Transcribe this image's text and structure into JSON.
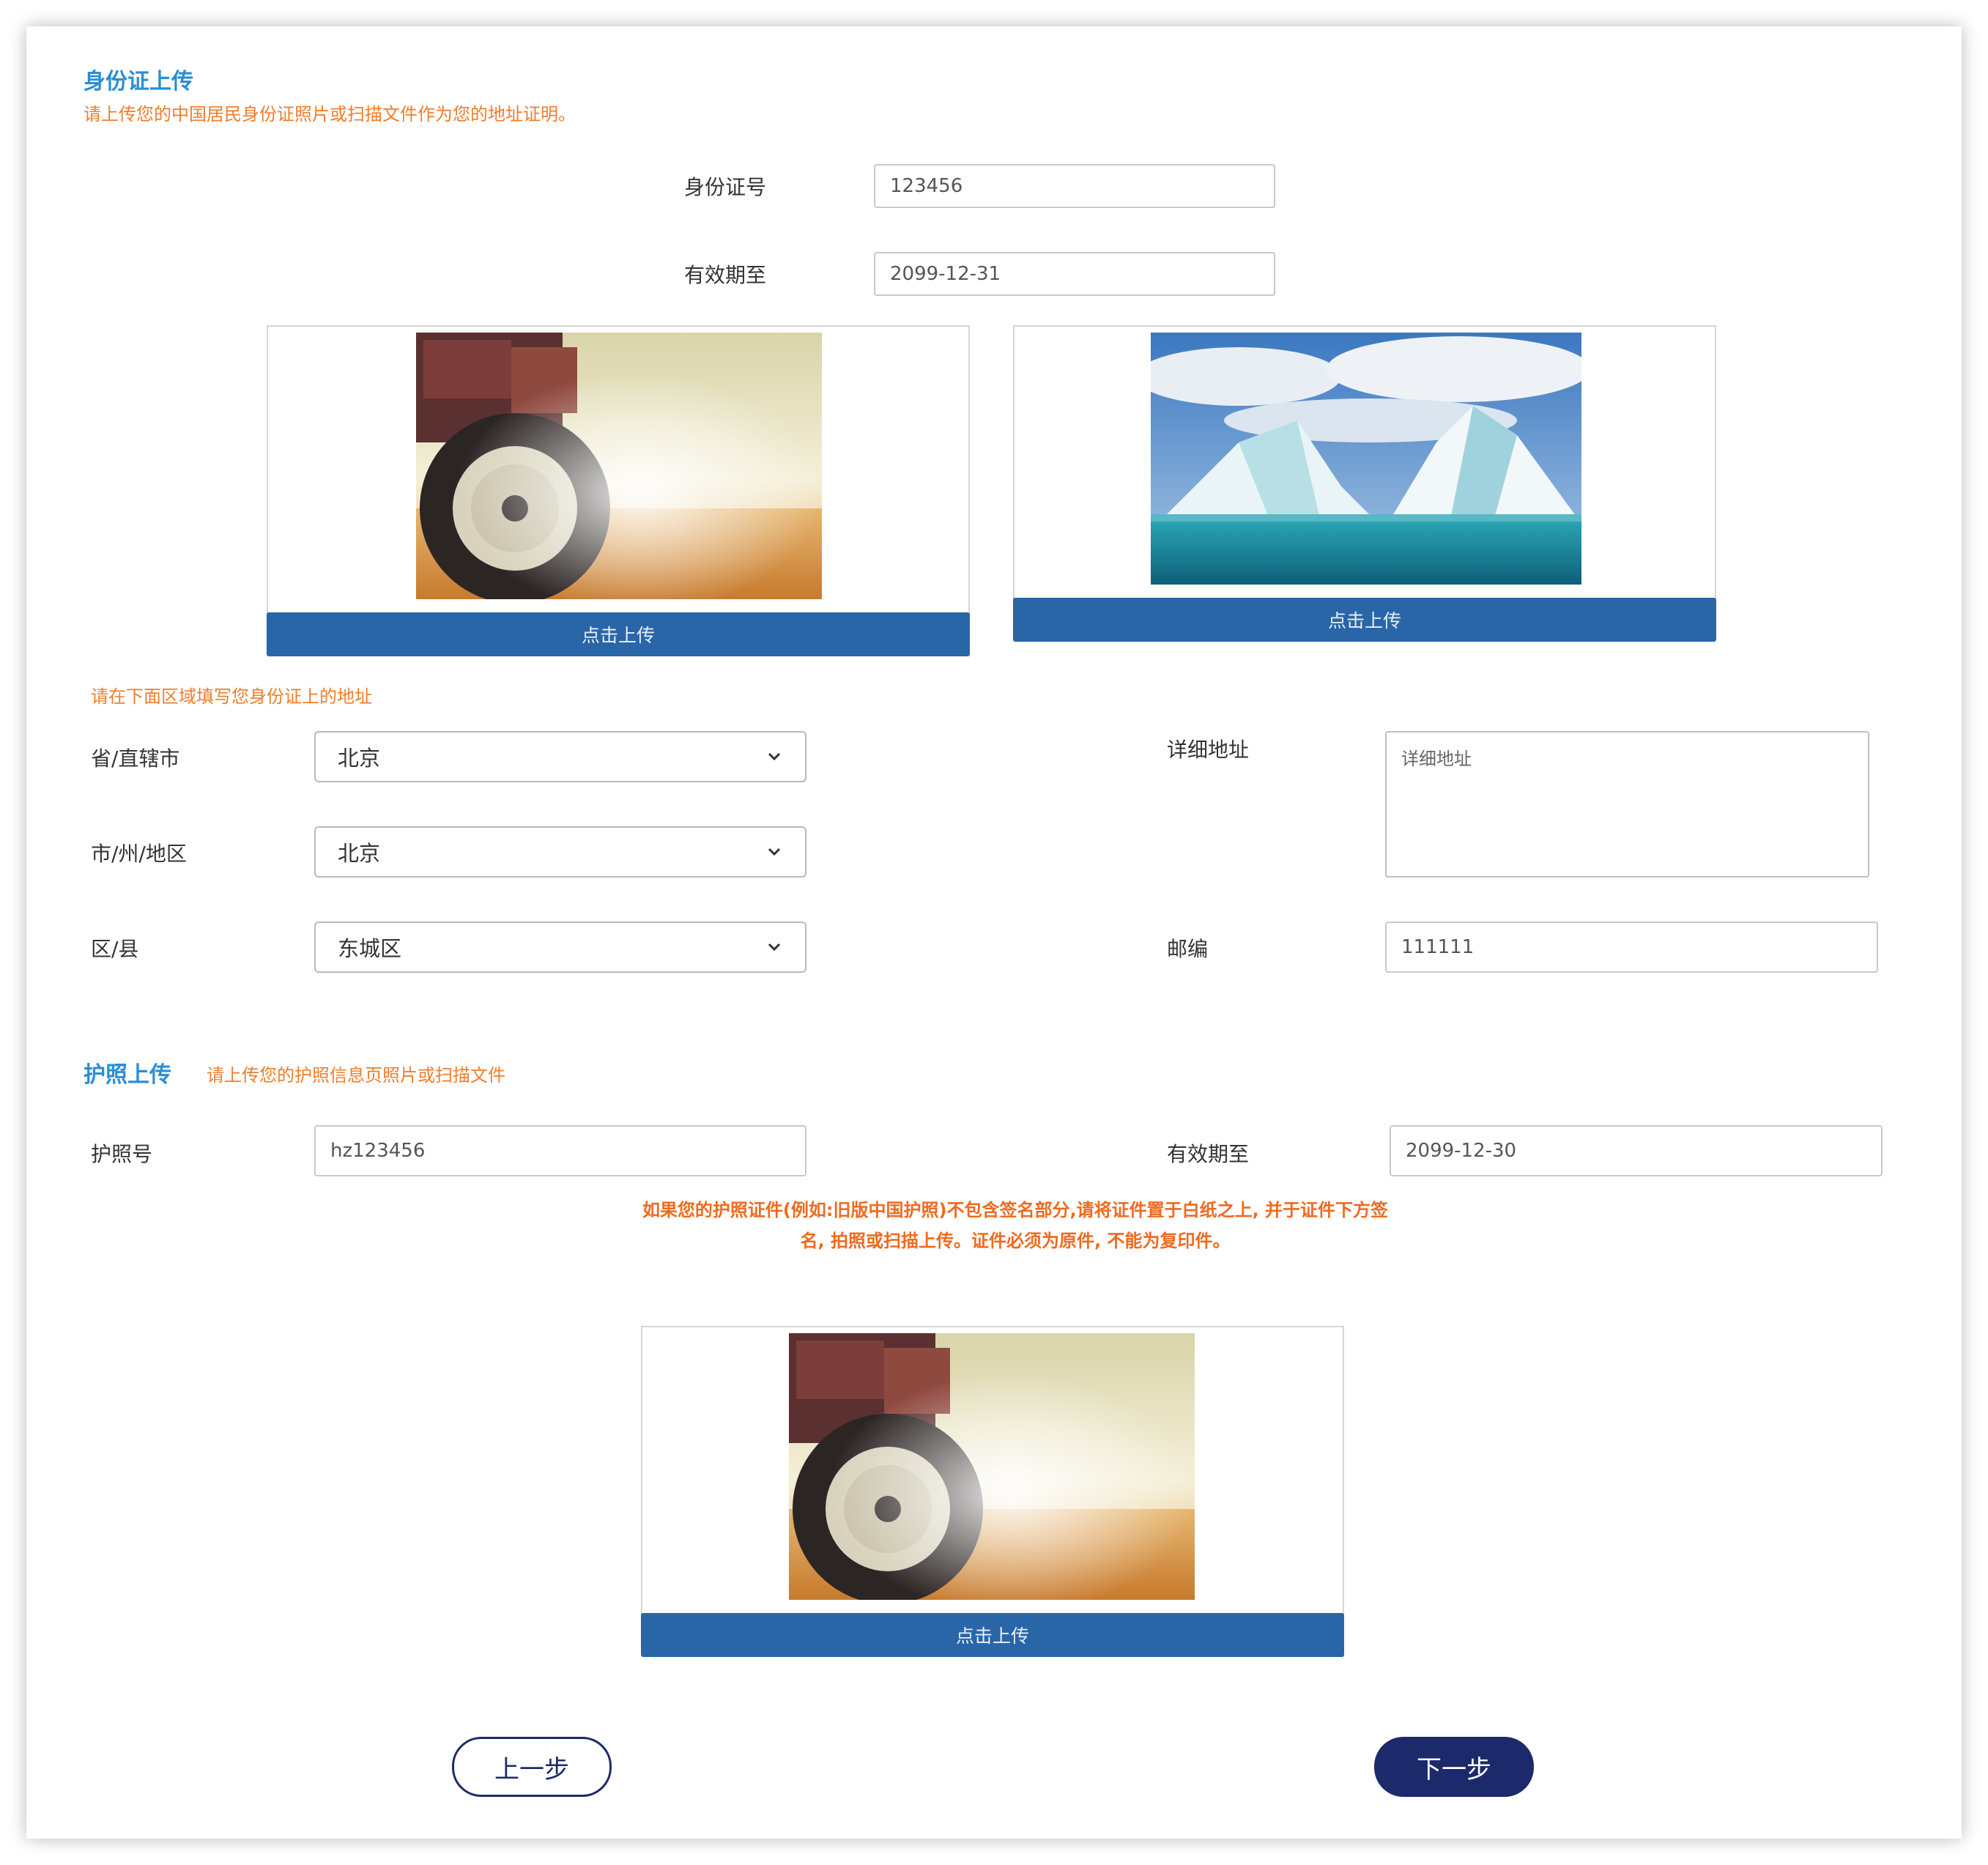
{
  "id_section": {
    "title": "身份证上传",
    "subtitle": "请上传您的中国居民身份证照片或扫描文件作为您的地址证明。",
    "id_number_label": "身份证号",
    "id_number_value": "123456",
    "expiry_label": "有效期至",
    "expiry_value": "2099-12-31",
    "front_upload_label": "点击上传",
    "back_upload_label": "点击上传"
  },
  "address": {
    "hint": "请在下面区域填写您身份证上的地址",
    "province_label": "省/直辖市",
    "province_value": "北京",
    "city_label": "市/州/地区",
    "city_value": "北京",
    "district_label": "区/县",
    "district_value": "东城区",
    "detail_label": "详细地址",
    "detail_placeholder": "详细地址",
    "postcode_label": "邮编",
    "postcode_value": "111111"
  },
  "passport_section": {
    "title": "护照上传",
    "subtitle": "请上传您的护照信息页照片或扫描文件",
    "passport_number_label": "护照号",
    "passport_number_value": "hz123456",
    "expiry_label": "有效期至",
    "expiry_value": "2099-12-30",
    "note_line1": "如果您的护照证件(例如:旧版中国护照)不包含签名部分,请将证件置于白纸之上, 并于证件下方签",
    "note_line2": "名, 拍照或扫描上传。证件必须为原件, 不能为复印件。",
    "upload_label": "点击上传"
  },
  "nav": {
    "prev_label": "上一步",
    "next_label": "下一步"
  },
  "colors": {
    "title_blue": "#2a8ed6",
    "hint_orange": "#f07d2a",
    "upload_button": "#2866a8",
    "nav_dark": "#1c2a6b"
  }
}
